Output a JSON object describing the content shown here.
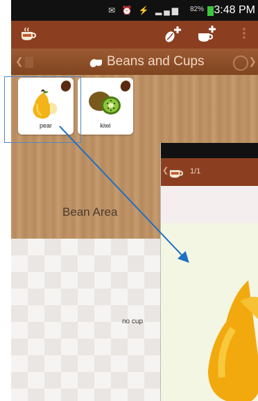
{
  "status_bar": {
    "battery": "82%",
    "time": "3:48 PM"
  },
  "title_bar": {
    "title": "Beans and Cups"
  },
  "bean_area": {
    "label": "Bean Area",
    "cards": [
      {
        "name": "pear"
      },
      {
        "name": "kiwi"
      }
    ]
  },
  "cup_area": {
    "empty_label": "no cup"
  },
  "zoom_view": {
    "page_indicator": "1/1"
  },
  "colors": {
    "action_bar": "#8b3f20",
    "accent_blue": "#1f6fc2"
  },
  "icons": [
    "app-cup-icon",
    "add-bean-icon",
    "add-cup-icon",
    "overflow-menu-icon",
    "left-arrow-icon",
    "door-icon",
    "bean-icon",
    "clock-icon",
    "right-arrow-icon",
    "pear-icon",
    "kiwi-icon"
  ]
}
